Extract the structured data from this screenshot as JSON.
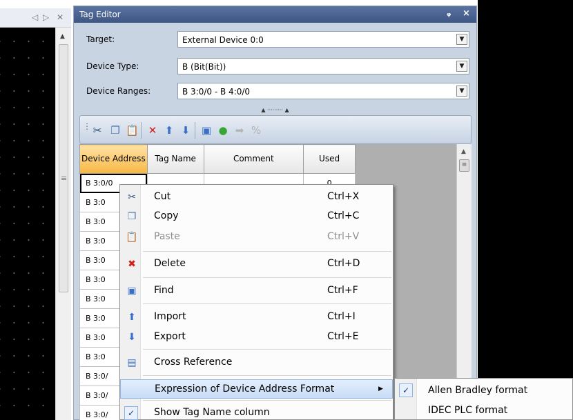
{
  "left_panel": {
    "nav_back": "◁",
    "nav_forward": "▷",
    "close": "✕",
    "scroll_up": "▲",
    "scroll_grip": "≡"
  },
  "tag_editor": {
    "title": "Tag Editor",
    "pin": "ᵩ",
    "close": "×",
    "fields": [
      {
        "label": "Target:",
        "value": "External Device 0:0"
      },
      {
        "label": "Device Type:",
        "value": "B (Bit(Bit))"
      },
      {
        "label": "Device Ranges:",
        "value": "B 3:0/0 - B 4:0/0"
      }
    ],
    "dropdown_glyph": "▼",
    "splitter_glyph": "▲ ········· ▲",
    "toolbar": [
      {
        "name": "cut-icon",
        "glyph": "✂",
        "color": "#33507d"
      },
      {
        "name": "copy-icon",
        "glyph": "❐",
        "color": "#4a76b8"
      },
      {
        "name": "paste-icon",
        "glyph": "📋",
        "color": "#8a8a8a"
      },
      {
        "name": "delete-icon",
        "glyph": "✕",
        "color": "#d3221c"
      },
      {
        "name": "import-icon",
        "glyph": "⬆",
        "color": "#3b6fc7"
      },
      {
        "name": "export-icon",
        "glyph": "⬇",
        "color": "#3b6fc7"
      },
      {
        "name": "find-icon",
        "glyph": "▣",
        "color": "#3b6fc7"
      },
      {
        "name": "refresh-icon",
        "glyph": "●",
        "color": "#3aa537"
      },
      {
        "name": "forward-icon",
        "glyph": "➡",
        "color": "#b4b4b4"
      },
      {
        "name": "percent-icon",
        "glyph": "%",
        "color": "#b4b4b4"
      }
    ]
  },
  "grid": {
    "columns": [
      "Device Address",
      "Tag Name",
      "Comment",
      "Used"
    ],
    "rows": [
      {
        "address": "B 3:0/0",
        "used": "0"
      },
      {
        "address": "B 3:0",
        "used": ""
      },
      {
        "address": "B 3:0",
        "used": ""
      },
      {
        "address": "B 3:0",
        "used": ""
      },
      {
        "address": "B 3:0",
        "used": ""
      },
      {
        "address": "B 3:0",
        "used": ""
      },
      {
        "address": "B 3:0",
        "used": ""
      },
      {
        "address": "B 3:0",
        "used": ""
      },
      {
        "address": "B 3:0",
        "used": ""
      },
      {
        "address": "B 3:0",
        "used": ""
      },
      {
        "address": "B 3:0/",
        "used": ""
      },
      {
        "address": "B 3:0/",
        "used": ""
      },
      {
        "address": "B 3:0/",
        "used": ""
      }
    ]
  },
  "context_menu": {
    "items": [
      {
        "label": "Cut",
        "shortcut": "Ctrl+X",
        "icon": "✂",
        "icon_color": "#33507d",
        "enabled": true
      },
      {
        "label": "Copy",
        "shortcut": "Ctrl+C",
        "icon": "❐",
        "icon_color": "#4a76b8",
        "enabled": true
      },
      {
        "label": "Paste",
        "shortcut": "Ctrl+V",
        "icon": "📋",
        "icon_color": "#9a9a9a",
        "enabled": false
      },
      {
        "label": "Delete",
        "shortcut": "Ctrl+D",
        "icon": "✖",
        "icon_color": "#d3221c",
        "enabled": true
      },
      {
        "label": "Find",
        "shortcut": "Ctrl+F",
        "icon": "▣",
        "icon_color": "#3b6fc7",
        "enabled": true
      },
      {
        "label": "Import",
        "shortcut": "Ctrl+I",
        "icon": "⬆",
        "icon_color": "#3b6fc7",
        "enabled": true
      },
      {
        "label": "Export",
        "shortcut": "Ctrl+E",
        "icon": "⬇",
        "icon_color": "#3b6fc7",
        "enabled": true
      },
      {
        "label": "Cross Reference",
        "shortcut": "",
        "icon": "▤",
        "icon_color": "#3b6fc7",
        "enabled": true
      },
      {
        "label": "Expression of Device Address Format",
        "shortcut": "",
        "icon": "",
        "has_submenu": true,
        "highlighted": true
      },
      {
        "label": "Show Tag Name column",
        "shortcut": "",
        "checked": true
      }
    ],
    "submenu_arrow": "▶",
    "check_glyph": "✓"
  },
  "submenu": {
    "items": [
      {
        "label": "Allen Bradley format",
        "checked": true
      },
      {
        "label": "IDEC PLC format",
        "checked": false
      }
    ]
  },
  "colors": {
    "panel_bg": "#c9d4e3",
    "title_bar": "#3e5683",
    "active_header": "#f7b844",
    "menu_highlight": "#c8ddf6"
  }
}
